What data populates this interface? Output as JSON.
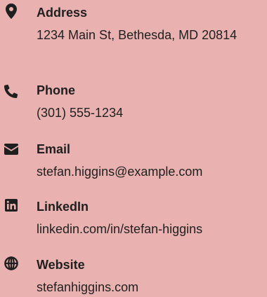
{
  "contacts": {
    "address": {
      "label": "Address",
      "value": "1234 Main St, Bethesda, MD 20814",
      "icon": "map-marker-icon"
    },
    "phone": {
      "label": "Phone",
      "value": "(301) 555-1234",
      "icon": "phone-icon"
    },
    "email": {
      "label": "Email",
      "value": "stefan.higgins@example.com",
      "icon": "envelope-icon"
    },
    "linkedin": {
      "label": "LinkedIn",
      "value": "linkedin.com/in/stefan-higgins",
      "icon": "linkedin-icon"
    },
    "website": {
      "label": "Website",
      "value": "stefanhiggins.com",
      "icon": "globe-icon"
    }
  },
  "theme": {
    "background": "#e9b2b0",
    "text": "#1f1f1f"
  }
}
